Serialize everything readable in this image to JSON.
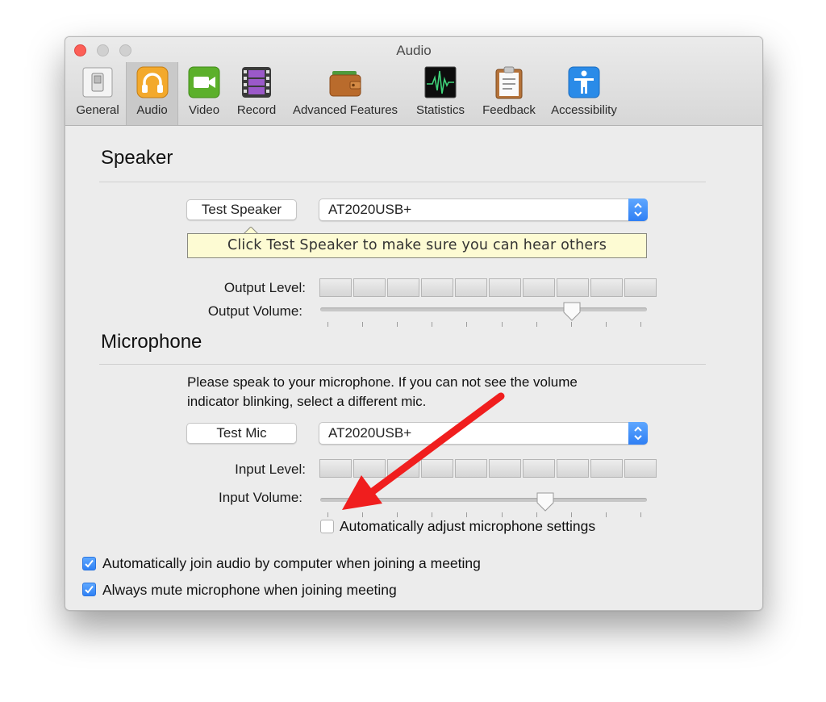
{
  "window": {
    "title": "Audio",
    "tabs": [
      {
        "label": "General",
        "icon": "general-switch-icon"
      },
      {
        "label": "Audio",
        "icon": "headphones-icon",
        "selected": true
      },
      {
        "label": "Video",
        "icon": "video-camera-icon"
      },
      {
        "label": "Record",
        "icon": "film-strip-icon"
      },
      {
        "label": "Advanced Features",
        "icon": "wallet-icon"
      },
      {
        "label": "Statistics",
        "icon": "waveform-icon"
      },
      {
        "label": "Feedback",
        "icon": "clipboard-icon"
      },
      {
        "label": "Accessibility",
        "icon": "accessibility-icon"
      }
    ]
  },
  "speaker": {
    "title": "Speaker",
    "test_button": "Test Speaker",
    "device": "AT2020USB+",
    "tooltip": "Click Test Speaker to make sure you can hear others",
    "output_level_label": "Output Level:",
    "output_volume_label": "Output Volume:",
    "output_level_lit_segments": 0,
    "output_volume_fraction": 0.77
  },
  "microphone": {
    "title": "Microphone",
    "instructions_line1": "Please speak to your microphone. If you can not see the volume",
    "instructions_line2": "indicator blinking, select a different mic.",
    "test_button": "Test Mic",
    "device": "AT2020USB+",
    "input_level_label": "Input Level:",
    "input_volume_label": "Input Volume:",
    "input_level_lit_segments": 0,
    "input_volume_fraction": 0.69,
    "auto_adjust_label": "Automatically adjust microphone settings",
    "auto_adjust_checked": false
  },
  "options": {
    "auto_join_label": "Automatically join audio by computer when joining a meeting",
    "auto_join_checked": true,
    "always_mute_label": "Always mute microphone when joining meeting",
    "always_mute_checked": true
  },
  "colors": {
    "accent": "#2f81f5",
    "annotation_arrow": "#f01e1e",
    "tooltip_bg": "#fdfbd3",
    "close_button": "#fc5f57"
  }
}
